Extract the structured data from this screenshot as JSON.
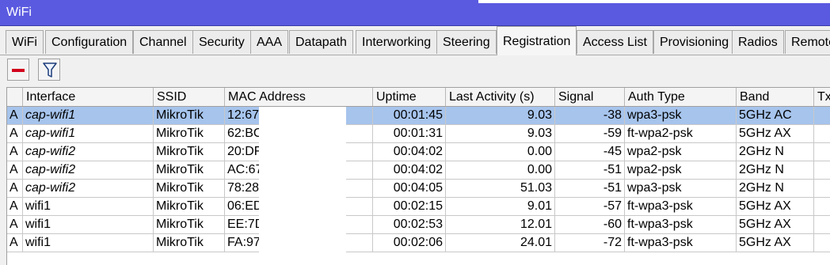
{
  "window": {
    "title": "WiFi"
  },
  "tabs": [
    {
      "label": "WiFi"
    },
    {
      "label": "Configuration"
    },
    {
      "label": "Channel"
    },
    {
      "label": "Security"
    },
    {
      "label": "AAA"
    },
    {
      "label": "Datapath"
    },
    {
      "label": "Interworking"
    },
    {
      "label": "Steering"
    },
    {
      "label": "Registration"
    },
    {
      "label": "Access List"
    },
    {
      "label": "Provisioning"
    },
    {
      "label": "Radios"
    },
    {
      "label": "Remote"
    }
  ],
  "active_tab": "Registration",
  "toolbar": {
    "remove_icon": "minus-icon",
    "filter_icon": "filter-icon"
  },
  "table": {
    "columns": [
      "",
      "Interface",
      "SSID",
      "MAC Address",
      "Uptime",
      "Last Activity (s)",
      "Signal",
      "Auth Type",
      "Band",
      "Tx"
    ],
    "rows": [
      {
        "flag": "A",
        "interface": "cap-wifi1",
        "ssid": "MikroTik",
        "mac": "12:67",
        "uptime": "00:01:45",
        "last_activity": "9.03",
        "signal": "-38",
        "auth": "wpa3-psk",
        "band": "5GHz AC",
        "tx": ""
      },
      {
        "flag": "A",
        "interface": "cap-wifi1",
        "ssid": "MikroTik",
        "mac": "62:BC",
        "uptime": "00:01:31",
        "last_activity": "9.03",
        "signal": "-59",
        "auth": "ft-wpa2-psk",
        "band": "5GHz AX",
        "tx": ""
      },
      {
        "flag": "A",
        "interface": "cap-wifi2",
        "ssid": "MikroTik",
        "mac": "20:DF",
        "uptime": "00:04:02",
        "last_activity": "0.00",
        "signal": "-45",
        "auth": "wpa2-psk",
        "band": "2GHz N",
        "tx": ""
      },
      {
        "flag": "A",
        "interface": "cap-wifi2",
        "ssid": "MikroTik",
        "mac": "AC:67",
        "uptime": "00:04:02",
        "last_activity": "0.00",
        "signal": "-51",
        "auth": "wpa2-psk",
        "band": "2GHz N",
        "tx": ""
      },
      {
        "flag": "A",
        "interface": "cap-wifi2",
        "ssid": "MikroTik",
        "mac": "78:28",
        "uptime": "00:04:05",
        "last_activity": "51.03",
        "signal": "-51",
        "auth": "wpa3-psk",
        "band": "2GHz N",
        "tx": ""
      },
      {
        "flag": "A",
        "interface": "wifi1",
        "ssid": "MikroTik",
        "mac": "06:ED",
        "uptime": "00:02:15",
        "last_activity": "9.01",
        "signal": "-57",
        "auth": "ft-wpa3-psk",
        "band": "5GHz AX",
        "tx": ""
      },
      {
        "flag": "A",
        "interface": "wifi1",
        "ssid": "MikroTik",
        "mac": "EE:7D",
        "uptime": "00:02:53",
        "last_activity": "12.01",
        "signal": "-60",
        "auth": "ft-wpa3-psk",
        "band": "5GHz AX",
        "tx": ""
      },
      {
        "flag": "A",
        "interface": "wifi1",
        "ssid": "MikroTik",
        "mac": "FA:97",
        "uptime": "00:02:06",
        "last_activity": "24.01",
        "signal": "-72",
        "auth": "ft-wpa3-psk",
        "band": "5GHz AX",
        "tx": ""
      }
    ],
    "selected_row": 0
  },
  "colors": {
    "titlebar": "#5a5ae0",
    "selection": "#a6c4ec",
    "remove_icon": "#d2001c"
  }
}
